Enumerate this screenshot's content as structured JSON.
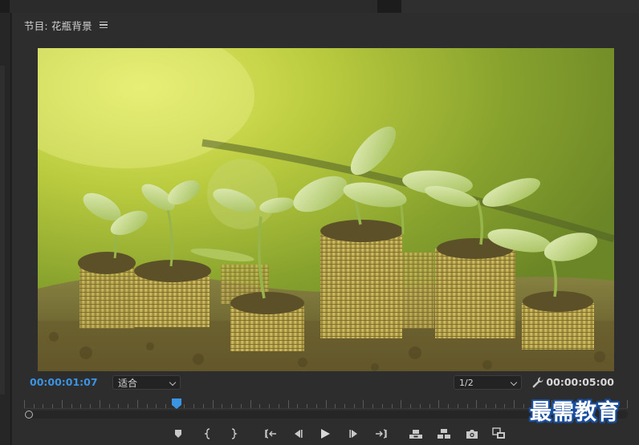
{
  "panel": {
    "title": "节目: 花瓶背景"
  },
  "timecode": {
    "current": "00:00:01:07",
    "total": "00:00:05:00"
  },
  "fit_select": {
    "value": "适合"
  },
  "resolution_select": {
    "value": "1/2"
  },
  "playhead_position_fraction": 0.26,
  "controls": [
    {
      "name": "add-marker-button",
      "icon": "marker-icon"
    },
    {
      "name": "mark-in-button",
      "icon": "mark-in-icon"
    },
    {
      "name": "mark-out-button",
      "icon": "mark-out-icon"
    },
    {
      "name": "go-to-in-button",
      "icon": "go-to-in-icon"
    },
    {
      "name": "step-back-button",
      "icon": "step-back-icon"
    },
    {
      "name": "play-button",
      "icon": "play-icon"
    },
    {
      "name": "step-forward-button",
      "icon": "step-forward-icon"
    },
    {
      "name": "go-to-out-button",
      "icon": "go-to-out-icon"
    },
    {
      "name": "lift-button",
      "icon": "lift-icon"
    },
    {
      "name": "extract-button",
      "icon": "extract-icon"
    },
    {
      "name": "export-frame-button",
      "icon": "camera-icon"
    },
    {
      "name": "comparison-view-button",
      "icon": "compare-icon"
    }
  ],
  "watermark": {
    "text": "最需教育"
  },
  "colors": {
    "timecode_accent": "#3b94e3",
    "panel_bg": "#2d2d2d",
    "watermark_outline": "#1a4fa0"
  }
}
